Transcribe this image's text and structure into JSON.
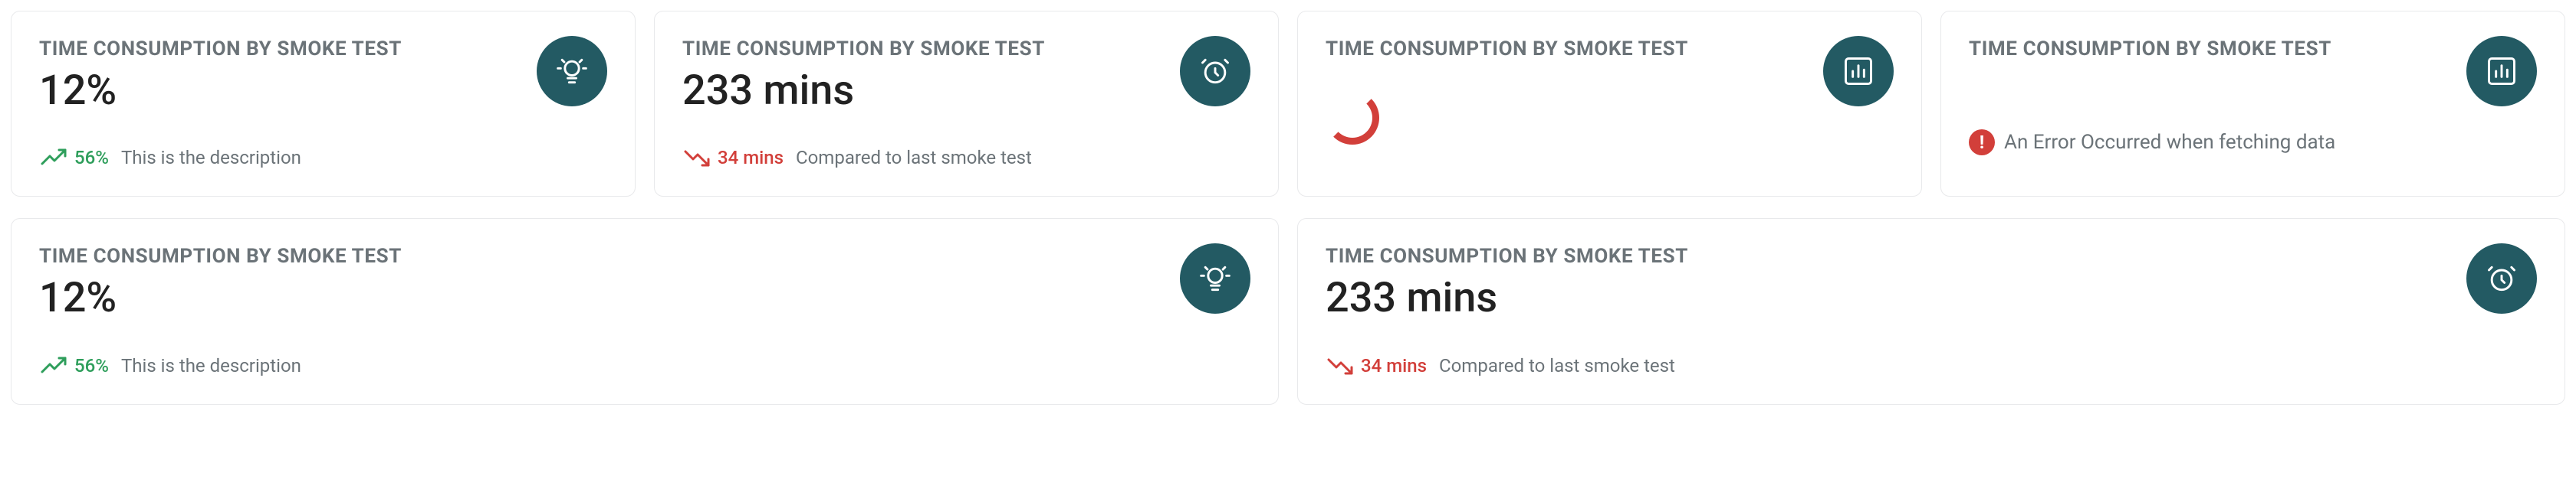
{
  "row1": {
    "cards": [
      {
        "title": "TIME CONSUMPTION BY SMOKE TEST",
        "value": "12%",
        "trend_direction": "up",
        "trend_value": "56%",
        "description": "This is the description",
        "icon": "lightbulb"
      },
      {
        "title": "TIME CONSUMPTION BY SMOKE TEST",
        "value": "233 mins",
        "trend_direction": "down",
        "trend_value": "34 mins",
        "description": "Compared to last smoke test",
        "icon": "clock"
      },
      {
        "title": "TIME CONSUMPTION BY SMOKE TEST",
        "state": "loading",
        "icon": "bar-chart"
      },
      {
        "title": "TIME CONSUMPTION BY SMOKE TEST",
        "state": "error",
        "error_message": "An Error Occurred when fetching data",
        "icon": "bar-chart"
      }
    ]
  },
  "row2": {
    "cards": [
      {
        "title": "TIME CONSUMPTION BY SMOKE TEST",
        "value": "12%",
        "trend_direction": "up",
        "trend_value": "56%",
        "description": "This is the description",
        "icon": "lightbulb"
      },
      {
        "title": "TIME CONSUMPTION BY SMOKE TEST",
        "value": "233 mins",
        "trend_direction": "down",
        "trend_value": "34 mins",
        "description": "Compared to last smoke test",
        "icon": "clock"
      }
    ]
  },
  "colors": {
    "teal": "#235a63",
    "green": "#2e9e5b",
    "red": "#d23f3a"
  }
}
